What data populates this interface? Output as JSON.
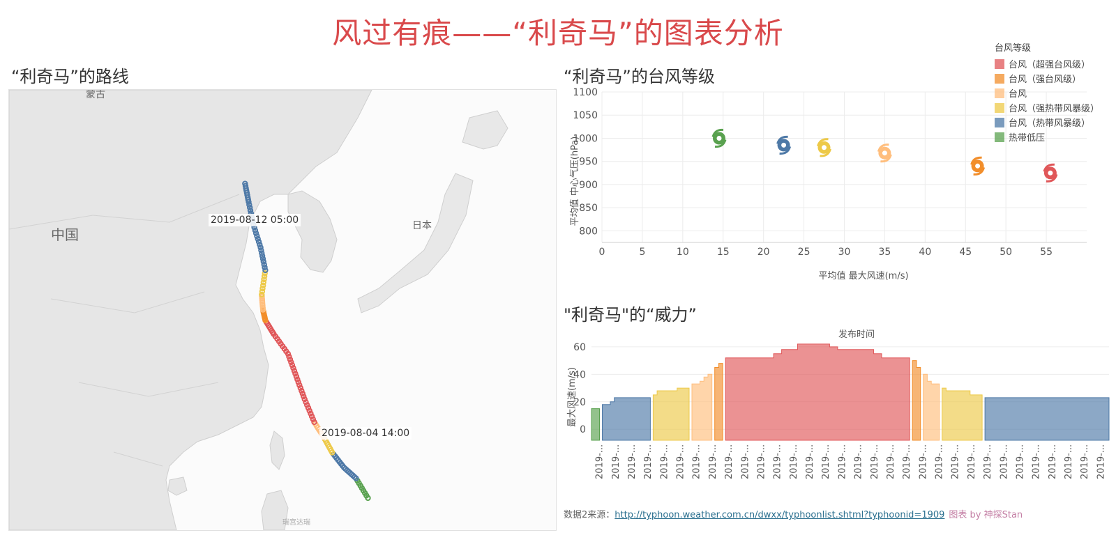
{
  "title": "风过有痕——“利奇马”的图表分析",
  "map": {
    "title": "“利奇马”的路线",
    "labels": {
      "mongolia": "蒙古",
      "china": "中国",
      "japan": "日本",
      "end_time": "2019-08-12 05:00",
      "start_time": "2019-08-04 14:00",
      "attribution": "瑞宫达瑞"
    }
  },
  "legend": {
    "title": "台风等级",
    "items": [
      {
        "label": "台风（超强台风级）",
        "color": "#e05759"
      },
      {
        "label": "台风（强台风级）",
        "color": "#f28e2b"
      },
      {
        "label": "台风",
        "color": "#ffbe7d"
      },
      {
        "label": "台风（强热带风暴级）",
        "color": "#edc948"
      },
      {
        "label": "台风（热带风暴级）",
        "color": "#4e79a7"
      },
      {
        "label": "热带低压",
        "color": "#59a14f"
      }
    ]
  },
  "scatter": {
    "title": "“利奇马”的台风等级",
    "xlabel": "平均值 最大风速(m/s)",
    "ylabel": "平均值 中心气压(hPa)",
    "xlim": [
      0,
      60
    ],
    "ylim": [
      775,
      1100
    ],
    "xticks": [
      0,
      5,
      10,
      15,
      20,
      25,
      30,
      35,
      40,
      45,
      50,
      55
    ],
    "yticks": [
      800,
      850,
      900,
      950,
      1000,
      1050,
      1100
    ]
  },
  "power": {
    "title": "\"利奇马\"的“威力”",
    "header": "发布时间",
    "ylabel": "最大风速(m/s)",
    "yticks": [
      0,
      20,
      40,
      60
    ],
    "ylim": [
      -8,
      64
    ],
    "xtick_label": "2019-..."
  },
  "source": {
    "prefix": "数据2来源：",
    "url": "http://typhoon.weather.com.cn/dwxx/typhoonlist.shtml?typhoonid=1909",
    "credit": "图表 by 神探Stan"
  },
  "chart_data": [
    {
      "type": "map",
      "title": "“利奇马”的路线",
      "start_label": "2019-08-04 14:00",
      "end_label": "2019-08-12 05:00",
      "track": [
        {
          "lon": 129.5,
          "lat": 16.5,
          "level": 5
        },
        {
          "lon": 128.5,
          "lat": 17.8,
          "level": 4
        },
        {
          "lon": 127.5,
          "lat": 18.5,
          "level": 4
        },
        {
          "lon": 126.5,
          "lat": 19.5,
          "level": 3
        },
        {
          "lon": 125.8,
          "lat": 20.5,
          "level": 2
        },
        {
          "lon": 125.0,
          "lat": 21.5,
          "level": 0
        },
        {
          "lon": 124.2,
          "lat": 23.0,
          "level": 0
        },
        {
          "lon": 123.5,
          "lat": 24.5,
          "level": 0
        },
        {
          "lon": 122.8,
          "lat": 26.0,
          "level": 0
        },
        {
          "lon": 121.6,
          "lat": 27.3,
          "level": 0
        },
        {
          "lon": 120.9,
          "lat": 28.2,
          "level": 1
        },
        {
          "lon": 120.7,
          "lat": 28.9,
          "level": 2
        },
        {
          "lon": 120.6,
          "lat": 29.9,
          "level": 3
        },
        {
          "lon": 120.9,
          "lat": 31.5,
          "level": 4
        },
        {
          "lon": 120.5,
          "lat": 33.0,
          "level": 4
        },
        {
          "lon": 119.9,
          "lat": 34.5,
          "level": 4
        },
        {
          "lon": 119.5,
          "lat": 36.0,
          "level": 4
        },
        {
          "lon": 119.2,
          "lat": 37.2,
          "level": 4
        }
      ]
    },
    {
      "type": "scatter",
      "title": "“利奇马”的台风等级",
      "xlabel": "平均值 最大风速(m/s)",
      "ylabel": "平均值 中心气压(hPa)",
      "xlim": [
        0,
        60
      ],
      "ylim": [
        775,
        1100
      ],
      "points": [
        {
          "x": 14.5,
          "y": 1000,
          "series": "热带低压"
        },
        {
          "x": 22.5,
          "y": 985,
          "series": "台风（热带风暴级）"
        },
        {
          "x": 27.5,
          "y": 980,
          "series": "台风（强热带风暴级）"
        },
        {
          "x": 35.0,
          "y": 968,
          "series": "台风"
        },
        {
          "x": 46.5,
          "y": 940,
          "series": "台风（强台风级）"
        },
        {
          "x": 55.5,
          "y": 925,
          "series": "台风（超强台风级）"
        }
      ]
    },
    {
      "type": "area",
      "title": "\"利奇马\"的“威力”",
      "xlabel": "发布时间",
      "ylabel": "最大风速(m/s)",
      "ylim": [
        -8,
        64
      ],
      "segments": [
        {
          "level": 5,
          "values": [
            15,
            15
          ]
        },
        {
          "level": 4,
          "values": [
            18,
            18,
            20,
            23,
            23,
            23,
            23,
            23,
            23,
            23,
            23,
            23
          ]
        },
        {
          "level": 3,
          "values": [
            25,
            28,
            28,
            28,
            28,
            28,
            30,
            30,
            30
          ]
        },
        {
          "level": 2,
          "values": [
            33,
            33,
            35,
            38,
            40
          ]
        },
        {
          "level": 1,
          "values": [
            45,
            48
          ]
        },
        {
          "level": 0,
          "values": [
            52,
            52,
            52,
            52,
            52,
            52,
            52,
            52,
            52,
            52,
            52,
            52,
            55,
            55,
            58,
            58,
            58,
            58,
            62,
            62,
            62,
            62,
            62,
            62,
            62,
            62,
            60,
            60,
            58,
            58,
            58,
            58,
            58,
            58,
            58,
            58,
            58,
            55,
            55,
            52,
            52,
            52,
            52,
            52,
            52,
            52
          ]
        },
        {
          "level": 1,
          "values": [
            50,
            45
          ]
        },
        {
          "level": 2,
          "values": [
            40,
            35,
            33,
            33
          ]
        },
        {
          "level": 3,
          "values": [
            30,
            28,
            28,
            28,
            28,
            28,
            28,
            25,
            25,
            25
          ]
        },
        {
          "level": 4,
          "values": [
            23,
            23,
            23,
            23,
            23,
            23,
            23,
            23,
            23,
            23,
            23,
            23,
            23,
            23,
            23,
            23,
            23,
            23,
            23,
            23,
            23,
            23,
            23,
            23,
            23,
            23,
            23,
            23,
            23,
            23,
            23
          ]
        }
      ],
      "x_tick_count": 32
    }
  ]
}
